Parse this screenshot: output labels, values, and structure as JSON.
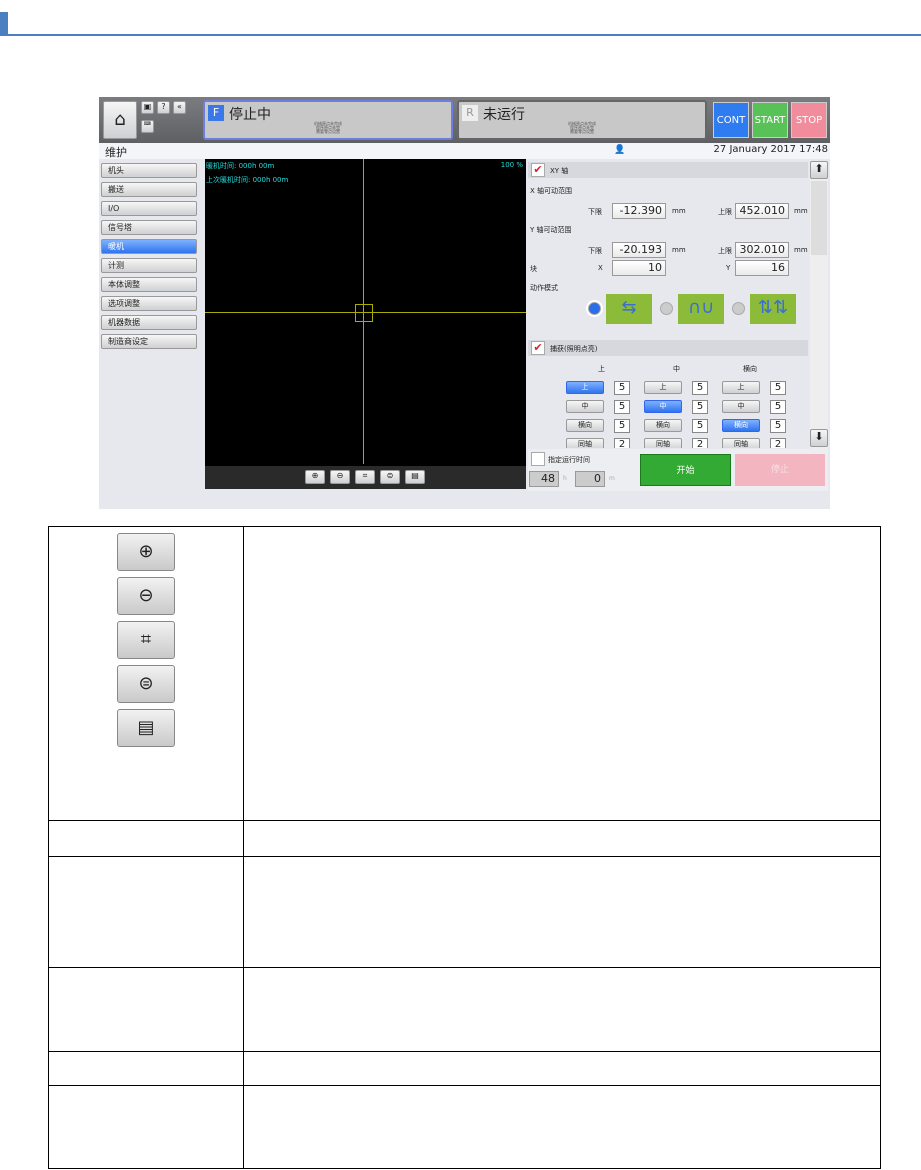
{
  "screen": {
    "status_f": {
      "letter": "F",
      "label": "停止中",
      "sub": [
        "机械原点未完成",
        "程序原点未完",
        "需要零点设置"
      ]
    },
    "status_r": {
      "letter": "R",
      "label": "未运行",
      "sub": [
        "机械原点未完成",
        "程序原点未完",
        "需要零点设置"
      ]
    },
    "top_icons": [
      "home-icon",
      "book-icon",
      "help-icon",
      "back-icon",
      "keyboard-icon"
    ],
    "help_label": "?",
    "control": {
      "cont": "CONT",
      "start": "START",
      "stop": "STOP",
      "cont_color": "#2f7bf0",
      "start_color": "#58c258",
      "stop_color": "#f08c9c"
    },
    "page_title": "维护",
    "datetime": "27 January 2017 17:48",
    "sidebar": [
      {
        "label": "机头"
      },
      {
        "label": "搬送"
      },
      {
        "label": "I/O"
      },
      {
        "label": "信号塔"
      },
      {
        "label": "暖机",
        "selected": true
      },
      {
        "label": "计测"
      },
      {
        "label": "本体调整"
      },
      {
        "label": "选项调整"
      },
      {
        "label": "机器数据"
      },
      {
        "label": "制造商设定"
      }
    ],
    "canvas": {
      "warmup_time": "暖机时间: 000h 00m",
      "last_warmup": "上次暖机时间: 000h 00m",
      "zoom": "100 %"
    },
    "xy": {
      "header": "XY 轴",
      "x_range": "X 轴可动范围",
      "y_range": "Y 轴可动范围",
      "lower": "下限",
      "upper": "上限",
      "unit": "mm",
      "x_lower": "-12.390",
      "x_upper": "452.010",
      "y_lower": "-20.193",
      "y_upper": "302.010",
      "block": "块",
      "bx_label": "X",
      "by_label": "Y",
      "bx": "10",
      "by": "16",
      "mode_label": "动作模式"
    },
    "capture": {
      "header": "捕获(照明点亮)",
      "cols": [
        "上",
        "中",
        "横向"
      ],
      "rows": [
        [
          "上",
          "5",
          "上",
          "5",
          "上",
          "5"
        ],
        [
          "中",
          "5",
          "中",
          "5",
          "中",
          "5"
        ],
        [
          "横向",
          "5",
          "横向",
          "5",
          "横向",
          "5"
        ],
        [
          "同轴",
          "2",
          "同轴",
          "2",
          "同轴",
          "2"
        ]
      ],
      "selected": [
        0,
        1,
        2
      ]
    },
    "runtime": {
      "label": "指定运行时间",
      "hours": "48",
      "h_unit": "h",
      "minutes": "0",
      "m_unit": "m"
    },
    "start_btn": "开始",
    "stop_btn": "停止"
  }
}
